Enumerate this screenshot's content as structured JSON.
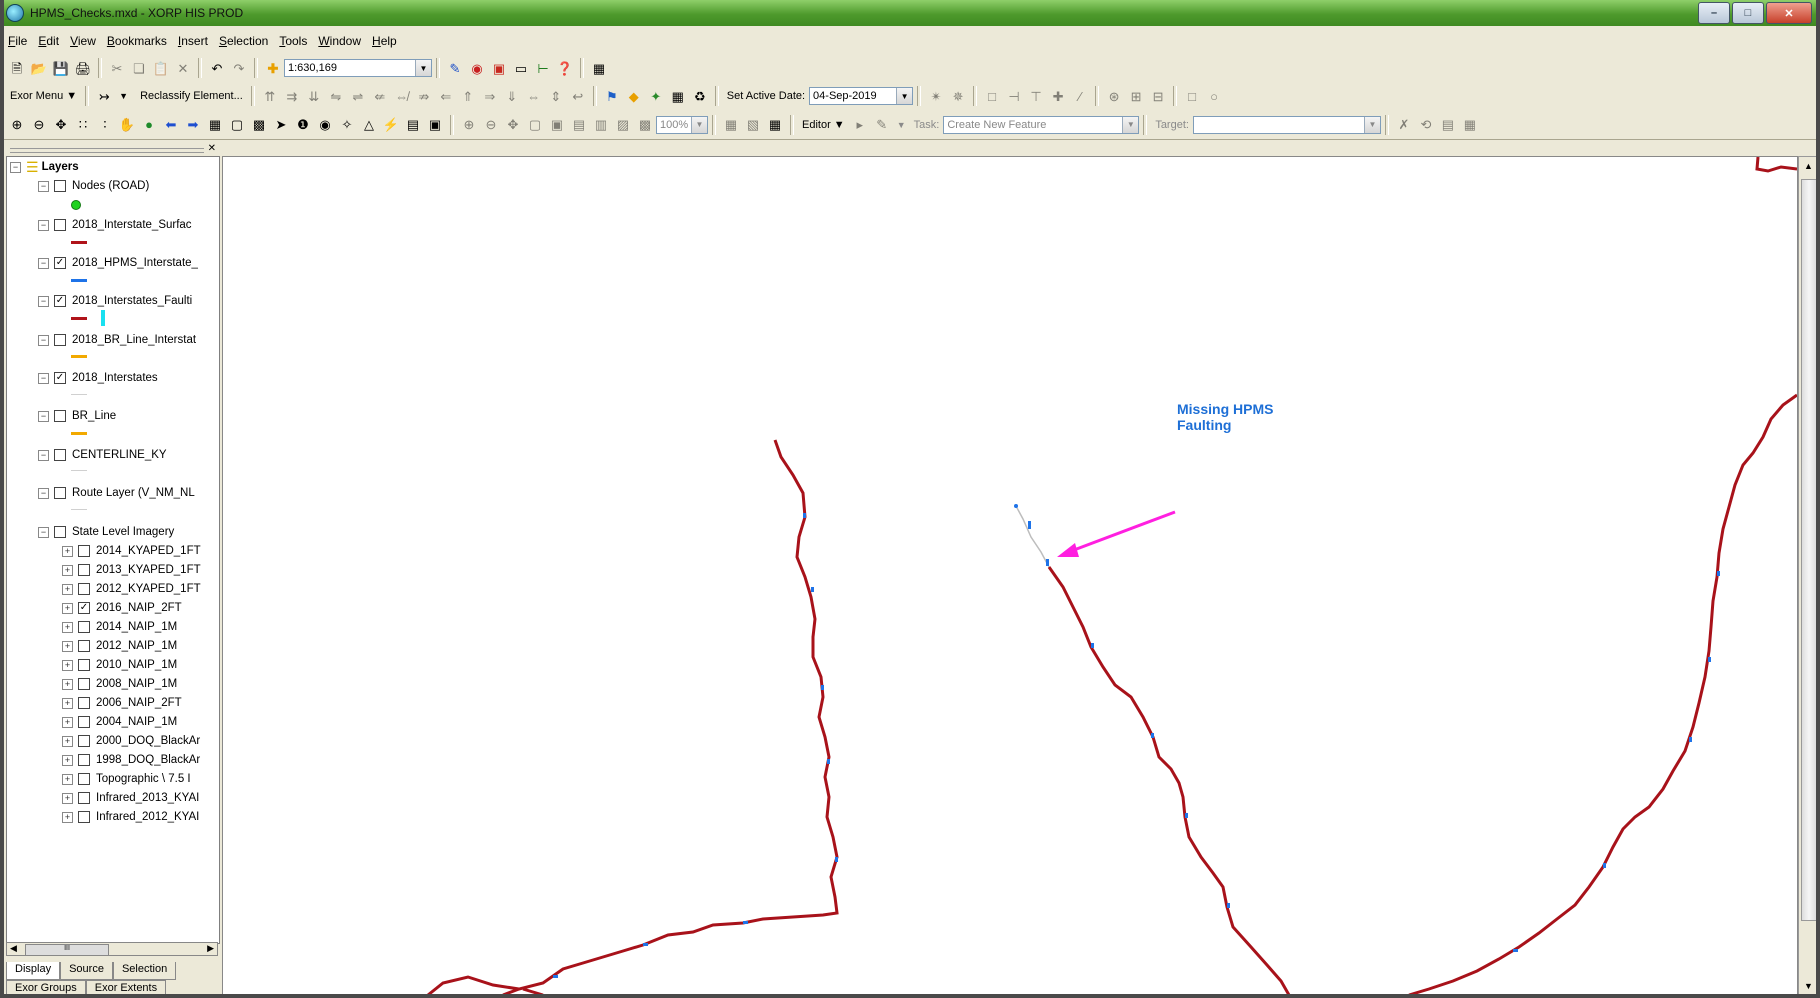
{
  "window": {
    "title": "HPMS_Checks.mxd - XORP HIS PROD"
  },
  "menu": [
    "File",
    "Edit",
    "View",
    "Bookmarks",
    "Insert",
    "Selection",
    "Tools",
    "Window",
    "Help"
  ],
  "toolbar1": {
    "scale": "1:630,169"
  },
  "toolbar2": {
    "exor_menu": "Exor Menu",
    "reclassify": "Reclassify Element...",
    "set_active_date_label": "Set Active Date:",
    "active_date": "04-Sep-2019"
  },
  "toolbar3": {
    "zoom": "100%",
    "editor": "Editor",
    "task_label": "Task:",
    "task_value": "Create New Feature",
    "target_label": "Target:"
  },
  "toc": {
    "root": "Layers",
    "layers": [
      {
        "name": "Nodes (ROAD)",
        "checked": false,
        "symbol": "#1fd21f"
      },
      {
        "name": "2018_Interstate_Surfac",
        "checked": false,
        "symbol": "#b0131a"
      },
      {
        "name": "2018_HPMS_Interstate_",
        "checked": true,
        "symbol": "#1e73e8"
      },
      {
        "name": "2018_Interstates_Faulti",
        "checked": true,
        "symbol": "#b0131a"
      },
      {
        "name": "2018_BR_Line_Interstat",
        "checked": false,
        "symbol": "#f2a900"
      },
      {
        "name": "2018_Interstates",
        "checked": true,
        "symbol": "#d8d8d8"
      },
      {
        "name": "BR_Line",
        "checked": false,
        "symbol": "#f2a900"
      },
      {
        "name": "CENTERLINE_KY",
        "checked": false,
        "symbol": "#d8d8d8"
      },
      {
        "name": "Route Layer (V_NM_NL",
        "checked": false,
        "symbol": "#d8d8d8"
      },
      {
        "name": "State Level Imagery",
        "checked": false
      }
    ],
    "imagery": [
      {
        "name": "2014_KYAPED_1FT",
        "checked": false
      },
      {
        "name": "2013_KYAPED_1FT",
        "checked": false
      },
      {
        "name": "2012_KYAPED_1FT",
        "checked": false
      },
      {
        "name": "2016_NAIP_2FT",
        "checked": true
      },
      {
        "name": "2014_NAIP_1M",
        "checked": false
      },
      {
        "name": "2012_NAIP_1M",
        "checked": false
      },
      {
        "name": "2010_NAIP_1M",
        "checked": false
      },
      {
        "name": "2008_NAIP_1M",
        "checked": false
      },
      {
        "name": "2006_NAIP_2FT",
        "checked": false
      },
      {
        "name": "2004_NAIP_1M",
        "checked": false
      },
      {
        "name": "2000_DOQ_BlackAr",
        "checked": false
      },
      {
        "name": "1998_DOQ_BlackAr",
        "checked": false
      },
      {
        "name": "Topographic \\ 7.5 I",
        "checked": false
      },
      {
        "name": "Infrared_2013_KYAI",
        "checked": false
      },
      {
        "name": "Infrared_2012_KYAI",
        "checked": false
      }
    ],
    "tabs": [
      "Display",
      "Source",
      "Selection"
    ],
    "tabs2": [
      "Exor Groups",
      "Exor Extents"
    ],
    "scroll_grip": "III"
  },
  "map": {
    "annotation_line1": "Missing HPMS",
    "annotation_line2": "Faulting",
    "road_color": "#a8121a",
    "fault_color": "#1e73e8",
    "arrow_color": "#ff1fe0"
  }
}
